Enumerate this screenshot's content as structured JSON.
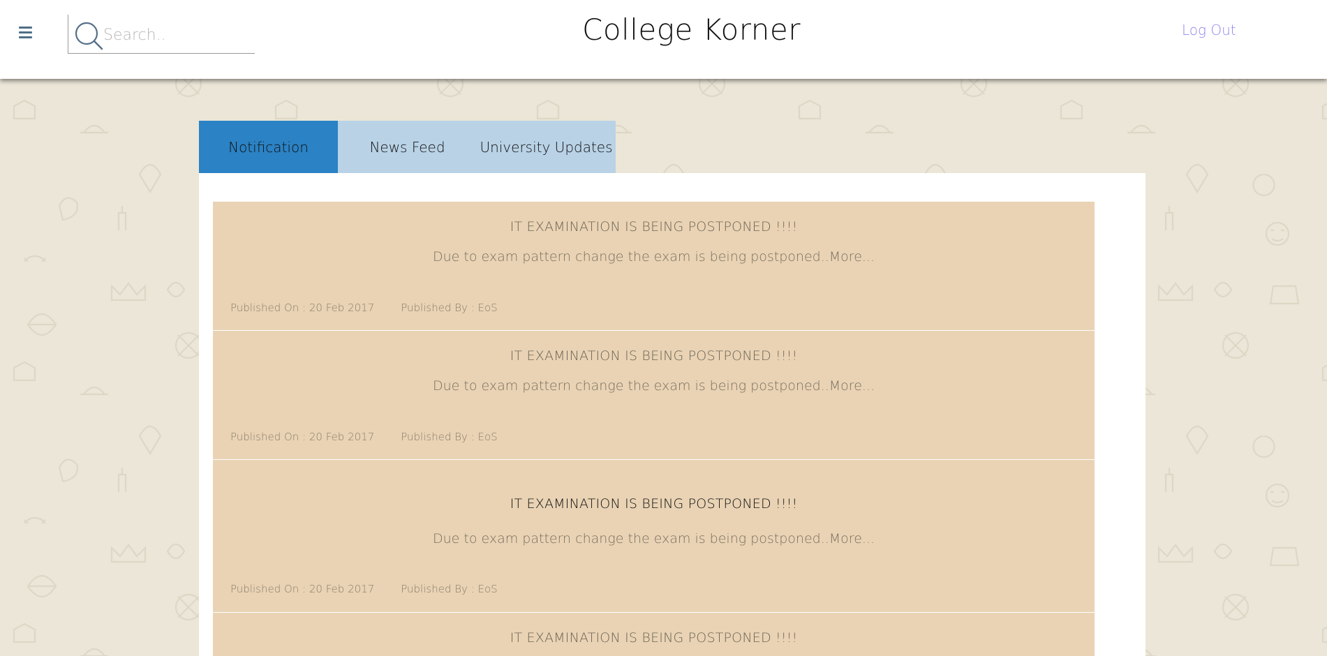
{
  "header": {
    "menu_icon": "hamburger-icon",
    "search": {
      "placeholder": "Search..",
      "value": "",
      "icon": "search-icon"
    },
    "title": "College Korner",
    "logout_label": "Log Out"
  },
  "tabs": [
    {
      "label": "Notification",
      "active": true
    },
    {
      "label": "News Feed",
      "active": false
    },
    {
      "label": "University Updates",
      "active": false
    }
  ],
  "notifications": [
    {
      "title": "IT EXAMINATION IS BEING POSTPONED !!!!",
      "description": "Due to exam pattern change the exam is being postponed..",
      "more_label": "More...",
      "published_on": "Published On : 20 Feb 2017",
      "published_by": "Published By : EoS"
    },
    {
      "title": "IT EXAMINATION IS BEING POSTPONED !!!!",
      "description": "Due to exam pattern change the exam is being postponed..",
      "more_label": "More...",
      "published_on": "Published On : 20 Feb 2017",
      "published_by": "Published By : EoS"
    },
    {
      "title": "IT EXAMINATION IS BEING POSTPONED !!!!",
      "description": "Due to exam pattern change the exam is being postponed..",
      "more_label": "More...",
      "published_on": "Published On : 20 Feb 2017",
      "published_by": "Published By : EoS"
    },
    {
      "title": "IT EXAMINATION IS BEING POSTPONED !!!!"
    }
  ],
  "colors": {
    "background": "#ebe6d7",
    "tab_active": "#2b82c4",
    "tab_inactive": "#b9d2e6",
    "card": "#e9d3b4",
    "logout": "#8c87ee"
  }
}
